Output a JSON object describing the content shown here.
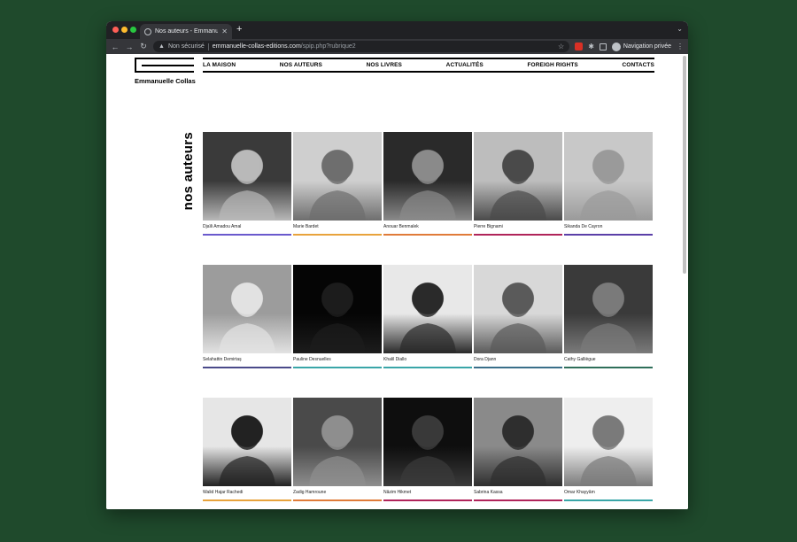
{
  "browser": {
    "tab_title": "Nos auteurs - Emmanuelle Colla",
    "new_tab": "+",
    "not_secure": "Non sécurisé",
    "url_host": "emmanuelle-collas-editions.com",
    "url_path": "/spip.php?rubrique2",
    "profile_label": "Navigation privée"
  },
  "site": {
    "logo_text": "Emmanuelle Collas",
    "nav": [
      "LA MAISON",
      "NOS AUTEURS",
      "NOS LIVRES",
      "ACTUALITÉS",
      "FOREIGH RIGHTS",
      "CONTACTS"
    ],
    "section_title": "nos auteurs"
  },
  "authors": [
    [
      {
        "name": "Djaïli Amadou Amal",
        "accent": "#6a5acd",
        "tone": [
          "#3a3a3a",
          "#b8b8b8"
        ]
      },
      {
        "name": "Marie Bardet",
        "accent": "#e8a33c",
        "tone": [
          "#cfcfcf",
          "#6e6e6e"
        ]
      },
      {
        "name": "Anouar Benmalek",
        "accent": "#e07b39",
        "tone": [
          "#2a2a2a",
          "#8a8a8a"
        ]
      },
      {
        "name": "Pierre Bignami",
        "accent": "#b0245a",
        "tone": [
          "#bdbdbd",
          "#4a4a4a"
        ]
      },
      {
        "name": "Sikanda De Cayron",
        "accent": "#5b3fa8",
        "tone": [
          "#c8c8c8",
          "#9a9a9a"
        ]
      }
    ],
    [
      {
        "name": "Selahattin Demirtaş",
        "accent": "#4a4a8a",
        "tone": [
          "#9c9c9c",
          "#e2e2e2"
        ]
      },
      {
        "name": "Pauline Desnuelles",
        "accent": "#3aa6a8",
        "tone": [
          "#050505",
          "#1c1c1c"
        ]
      },
      {
        "name": "Khalil Diallo",
        "accent": "#3aa6a8",
        "tone": [
          "#e8e8e8",
          "#2a2a2a"
        ]
      },
      {
        "name": "Dora Djann",
        "accent": "#3a6f8a",
        "tone": [
          "#d8d8d8",
          "#5a5a5a"
        ]
      },
      {
        "name": "Cathy Galliègue",
        "accent": "#2f6f5a",
        "tone": [
          "#3a3a3a",
          "#7a7a7a"
        ]
      }
    ],
    [
      {
        "name": "Walid Hajar Rachedi",
        "accent": "#e8a33c",
        "tone": [
          "#e6e6e6",
          "#222222"
        ]
      },
      {
        "name": "Zadig Hamroune",
        "accent": "#e07b39",
        "tone": [
          "#4a4a4a",
          "#8e8e8e"
        ]
      },
      {
        "name": "Nâzim Hikmet",
        "accent": "#b0245a",
        "tone": [
          "#0e0e0e",
          "#3a3a3a"
        ]
      },
      {
        "name": "Sabrina Kassa",
        "accent": "#b0245a",
        "tone": [
          "#8a8a8a",
          "#2e2e2e"
        ]
      },
      {
        "name": "Omar Khayyâm",
        "accent": "#3aa6a8",
        "tone": [
          "#eeeeee",
          "#7a7a7a"
        ]
      }
    ]
  ]
}
